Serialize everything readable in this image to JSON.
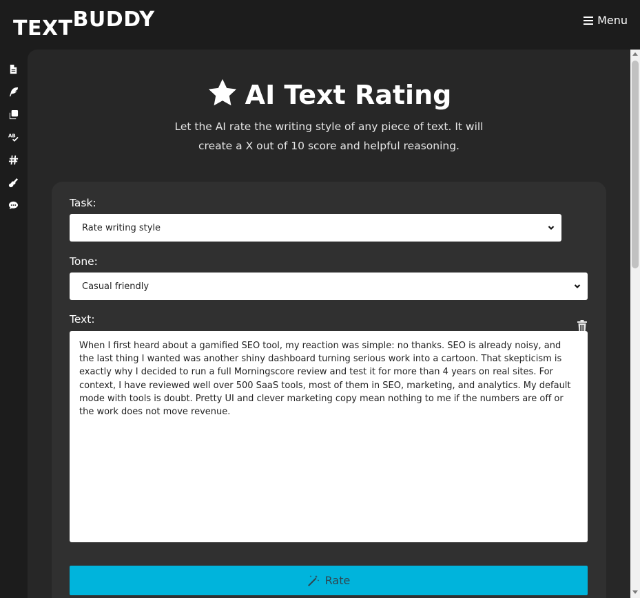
{
  "app": {
    "logo_part1": "TEXT",
    "logo_part2": "BUDDY",
    "menu_label": "Menu"
  },
  "sidebar": {
    "items": [
      {
        "icon": "document-icon"
      },
      {
        "icon": "feather-icon"
      },
      {
        "icon": "copy-icon"
      },
      {
        "icon": "spellcheck-icon"
      },
      {
        "icon": "hashtag-icon"
      },
      {
        "icon": "guitar-icon"
      },
      {
        "icon": "comment-icon"
      }
    ]
  },
  "page": {
    "title": "AI Text Rating",
    "subtitle": "Let the AI rate the writing style of any piece of text. It will create a X out of 10 score and helpful reasoning."
  },
  "form": {
    "task_label": "Task:",
    "task_value": "Rate writing style",
    "tone_label": "Tone:",
    "tone_value": "Casual friendly",
    "text_label": "Text:",
    "text_value": "When I first heard about a gamified SEO tool, my reaction was simple: no thanks. SEO is already noisy, and the last thing I wanted was another shiny dashboard turning serious work into a cartoon. That skepticism is exactly why I decided to run a full Morningscore review and test it for more than 4 years on real sites. For context, I have reviewed well over 500 SaaS tools, most of them in SEO, marketing, and analytics. My default mode with tools is doubt. Pretty UI and clever marketing copy mean nothing to me if the numbers are off or the work does not move revenue.",
    "rate_label": "Rate"
  },
  "colors": {
    "background": "#1c1c1c",
    "panel": "#272727",
    "card": "#303030",
    "accent": "#00b4dc"
  }
}
